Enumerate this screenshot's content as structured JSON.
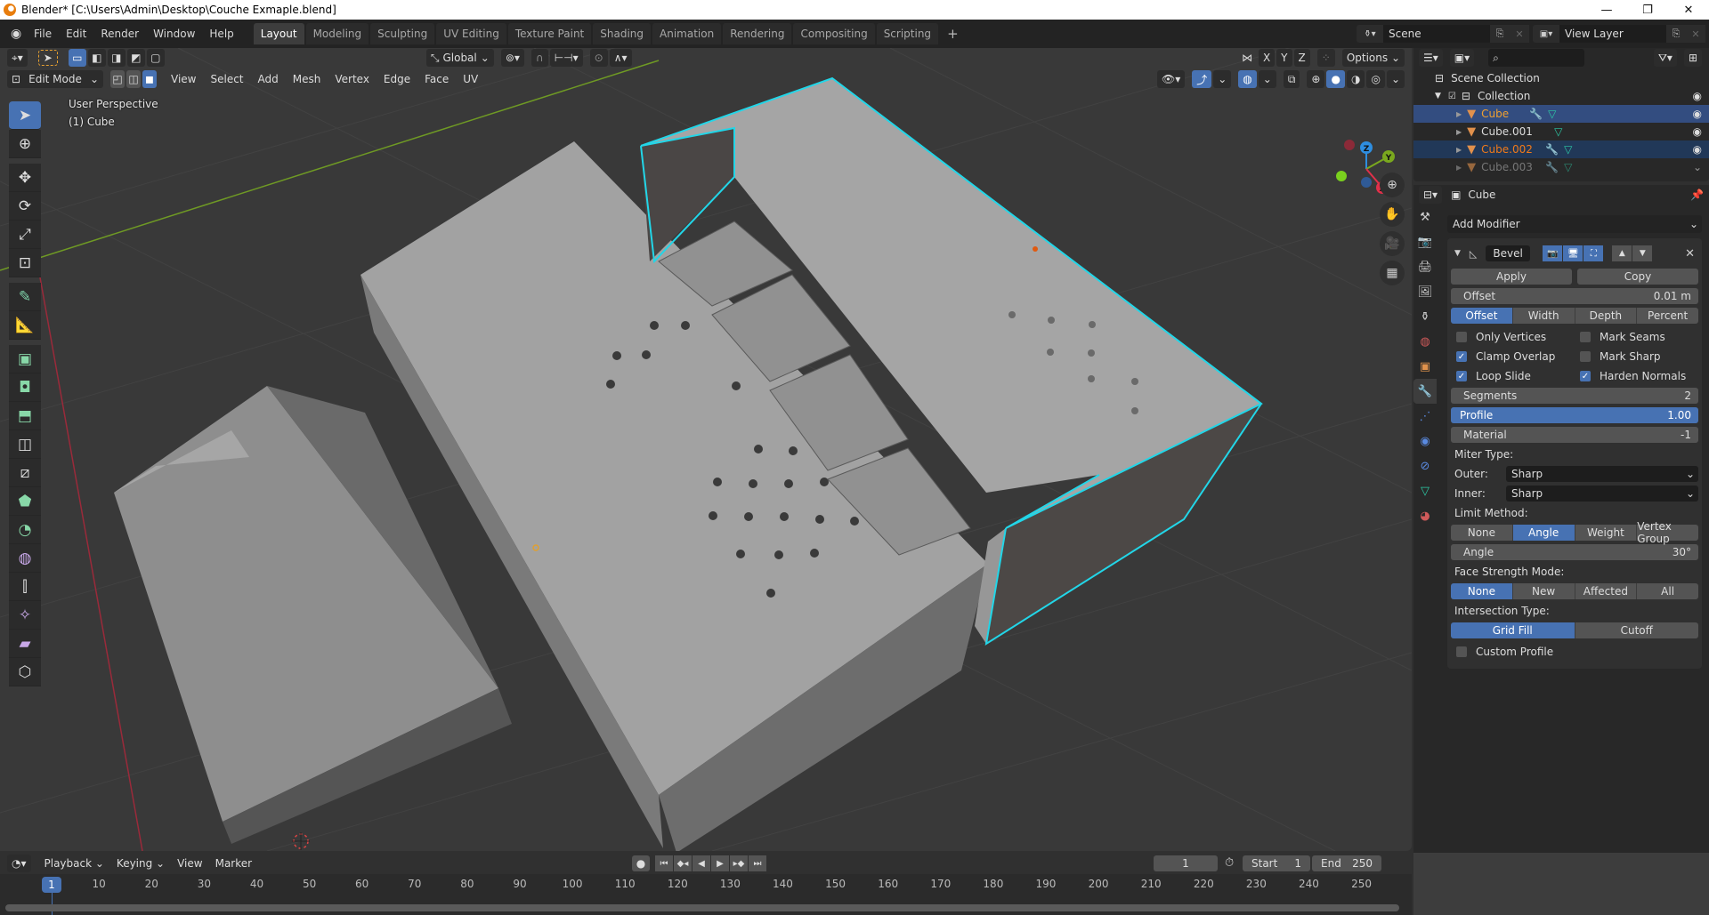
{
  "window": {
    "title": "Blender* [C:\\Users\\Admin\\Desktop\\Couche Exmaple.blend]",
    "controls": [
      "minimize",
      "maximize",
      "close"
    ]
  },
  "menubar": {
    "items": [
      "File",
      "Edit",
      "Render",
      "Window",
      "Help"
    ]
  },
  "workspace_tabs": [
    {
      "label": "Layout",
      "active": true
    },
    {
      "label": "Modeling"
    },
    {
      "label": "Sculpting"
    },
    {
      "label": "UV Editing"
    },
    {
      "label": "Texture Paint"
    },
    {
      "label": "Shading"
    },
    {
      "label": "Animation"
    },
    {
      "label": "Rendering"
    },
    {
      "label": "Compositing"
    },
    {
      "label": "Scripting"
    },
    {
      "label": "+"
    }
  ],
  "scene": {
    "name": "Scene",
    "view_layer": "View Layer"
  },
  "viewport": {
    "mode": "Edit Mode",
    "menus": [
      "View",
      "Select",
      "Add",
      "Mesh",
      "Vertex",
      "Edge",
      "Face",
      "UV"
    ],
    "transform_orientation": "Global",
    "axis_buttons": [
      "X",
      "Y",
      "Z"
    ],
    "options_label": "Options",
    "perspective_label": "User Perspective",
    "object_label": "(1) Cube",
    "gizmo_axes": [
      "Z",
      "Y",
      "X"
    ],
    "nav_icons": [
      "zoom-icon",
      "pan-hand-icon",
      "camera-icon",
      "grid-icon"
    ],
    "tools": [
      "select-box",
      "cursor",
      "move",
      "rotate",
      "scale",
      "transform",
      "annotate",
      "measure",
      "extrude",
      "inset",
      "bevel",
      "loop-cut",
      "knife",
      "poly-build",
      "spin",
      "smooth",
      "edge-slide",
      "shrink-fatten",
      "shear",
      "rip"
    ],
    "accent_selection": "#22d6e8"
  },
  "outliner": {
    "root": "Scene Collection",
    "collection": "Collection",
    "objects": [
      {
        "name": "Cube",
        "selected": "active",
        "has_modifier": true,
        "name_color": "#f0a030"
      },
      {
        "name": "Cube.001",
        "selected": "none",
        "has_modifier": false,
        "name_color": "#dddddd"
      },
      {
        "name": "Cube.002",
        "selected": "selected",
        "has_modifier": true,
        "name_color": "#f07a1a"
      },
      {
        "name": "Cube.003",
        "selected": "none",
        "has_modifier": true,
        "name_color": "#8a8a8a"
      }
    ]
  },
  "properties": {
    "object_name": "Cube",
    "add_modifier_label": "Add Modifier",
    "modifier": {
      "name": "Bevel",
      "apply_label": "Apply",
      "copy_label": "Copy",
      "offset_field": {
        "label": "Offset",
        "value": "0.01 m"
      },
      "width_types": [
        "Offset",
        "Width",
        "Depth",
        "Percent"
      ],
      "width_type_active": "Offset",
      "checks": [
        {
          "label": "Only Vertices",
          "checked": false
        },
        {
          "label": "Mark Seams",
          "checked": false
        },
        {
          "label": "Clamp Overlap",
          "checked": true
        },
        {
          "label": "Mark Sharp",
          "checked": false
        },
        {
          "label": "Loop Slide",
          "checked": true
        },
        {
          "label": "Harden Normals",
          "checked": true
        }
      ],
      "segments": {
        "label": "Segments",
        "value": "2"
      },
      "profile": {
        "label": "Profile",
        "value": "1.00"
      },
      "material": {
        "label": "Material",
        "value": "-1"
      },
      "miter_type_label": "Miter Type:",
      "outer": {
        "label": "Outer:",
        "value": "Sharp"
      },
      "inner": {
        "label": "Inner:",
        "value": "Sharp"
      },
      "limit_method_label": "Limit Method:",
      "limit_methods": [
        "None",
        "Angle",
        "Weight",
        "Vertex Group"
      ],
      "limit_method_active": "Angle",
      "angle": {
        "label": "Angle",
        "value": "30°"
      },
      "face_strength_label": "Face Strength Mode:",
      "face_strength_modes": [
        "None",
        "New",
        "Affected",
        "All"
      ],
      "face_strength_active": "None",
      "intersection_label": "Intersection Type:",
      "intersection_types": [
        "Grid Fill",
        "Cutoff"
      ],
      "intersection_active": "Grid Fill",
      "custom_profile": {
        "label": "Custom Profile",
        "checked": false
      }
    }
  },
  "timeline": {
    "menus": [
      "Playback",
      "Keying",
      "View",
      "Marker"
    ],
    "current_frame": "1",
    "start_label": "Start",
    "start": "1",
    "end_label": "End",
    "end": "250",
    "ticks": [
      "10",
      "20",
      "30",
      "40",
      "50",
      "60",
      "70",
      "80",
      "90",
      "100",
      "110",
      "120",
      "130",
      "140",
      "150",
      "160",
      "170",
      "180",
      "190",
      "200",
      "210",
      "220",
      "230",
      "240",
      "250"
    ]
  }
}
